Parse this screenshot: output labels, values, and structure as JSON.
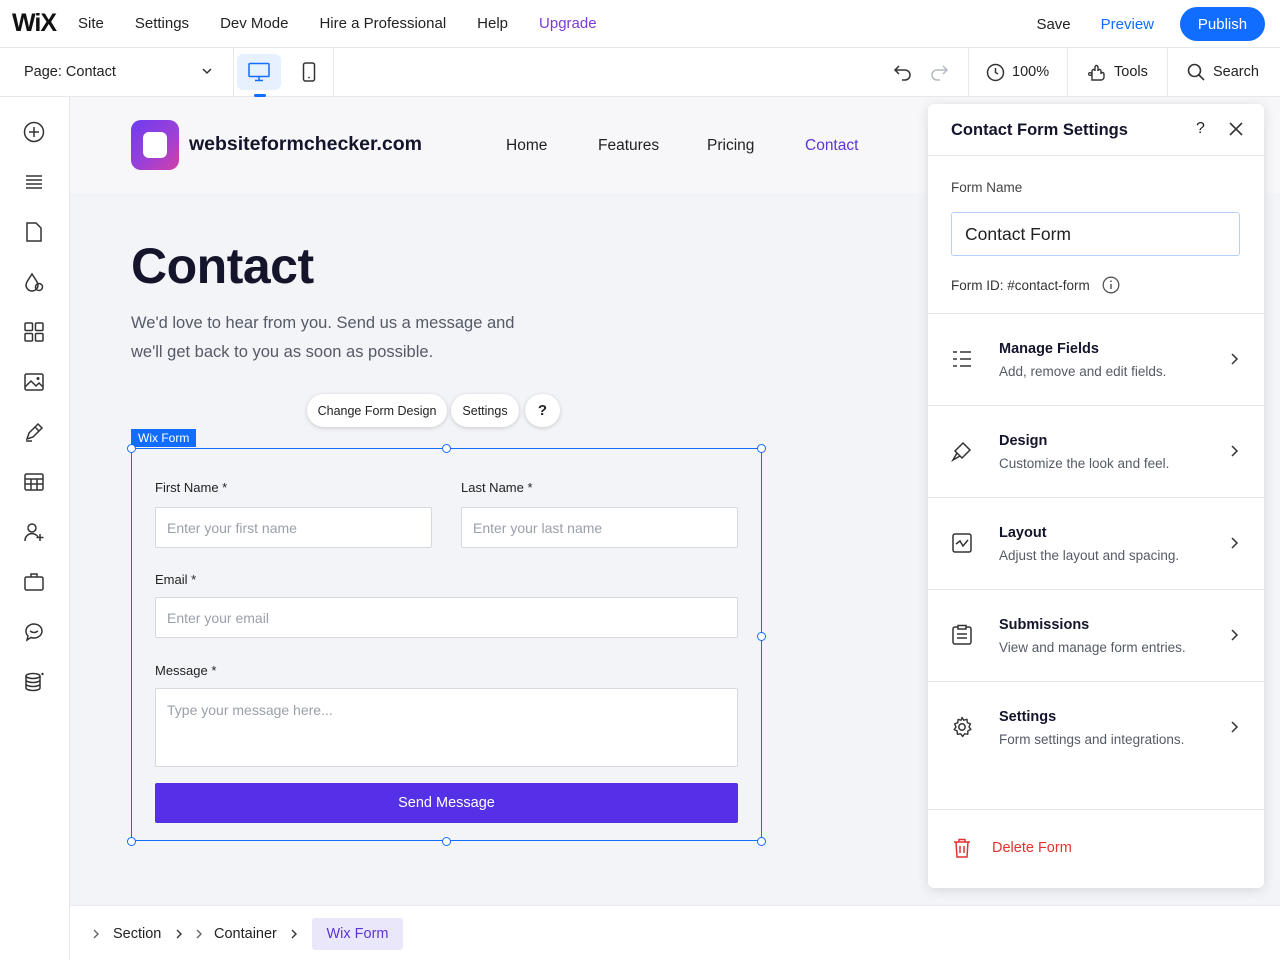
{
  "topbar": {
    "logo": "WiX",
    "nav": [
      "Site",
      "Settings",
      "Dev Mode",
      "Hire a Professional",
      "Help",
      "Upgrade"
    ],
    "save": "Save",
    "preview": "Preview",
    "publish": "Publish"
  },
  "subbar": {
    "page_label": "Page: Contact",
    "zoom": "100%",
    "tools": "Tools",
    "search": "Search"
  },
  "site": {
    "name": "websiteformchecker.com",
    "nav": [
      "Home",
      "Features",
      "Pricing",
      "Contact"
    ],
    "active_nav": "Contact",
    "heading": "Contact",
    "lead_line1": "We'd love to hear from you. Send us a message and",
    "lead_line2": "we'll get back to you as soon as possible."
  },
  "floating": {
    "change_design": "Change Form Design",
    "settings": "Settings",
    "help": "?"
  },
  "form": {
    "tag": "Wix Form",
    "first_label": "First Name *",
    "first_placeholder": "Enter your first name",
    "last_label": "Last Name *",
    "last_placeholder": "Enter your last name",
    "email_label": "Email *",
    "email_placeholder": "Enter your email",
    "message_label": "Message *",
    "message_placeholder": "Type your message here...",
    "submit": "Send Message"
  },
  "breadcrumb": {
    "items": [
      "Section",
      "Container",
      "Wix Form"
    ]
  },
  "panel": {
    "title": "Contact Form Settings",
    "help": "?",
    "form_name_label": "Form Name",
    "form_name_value": "Contact Form",
    "form_id": "Form ID: #contact-form",
    "rows": [
      {
        "title": "Manage Fields",
        "desc": "Add, remove and edit fields.",
        "icon": "list-icon"
      },
      {
        "title": "Design",
        "desc": "Customize the look and feel.",
        "icon": "brush-icon"
      },
      {
        "title": "Layout",
        "desc": "Adjust the layout and spacing.",
        "icon": "layout-icon"
      },
      {
        "title": "Submissions",
        "desc": "View and manage form entries.",
        "icon": "submissions-icon"
      },
      {
        "title": "Settings",
        "desc": "Form settings and integrations.",
        "icon": "gear-icon"
      }
    ],
    "delete": "Delete Form"
  },
  "colors": {
    "accent": "#116dff",
    "brand_purple": "#5b35d5",
    "button": "#5530e6",
    "danger": "#e0332f",
    "upgrade": "#7d3ad8"
  }
}
